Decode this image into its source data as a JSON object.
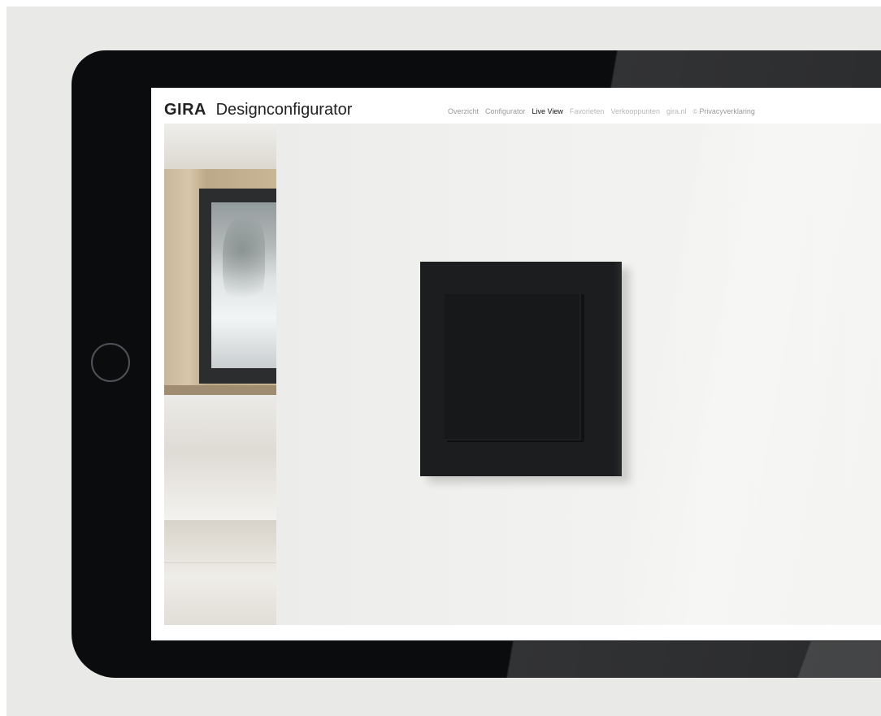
{
  "app": {
    "brand": "GIRA",
    "title": "Designconfigurator"
  },
  "nav": {
    "items": [
      {
        "label": "Overzicht"
      },
      {
        "label": "Configurator"
      },
      {
        "label": "Live View"
      },
      {
        "label": "Favorieten"
      },
      {
        "label": "Verkooppunten"
      },
      {
        "label": "gira.nl"
      }
    ],
    "privacy_label": "Privacyverklaring",
    "privacy_icon": "©"
  },
  "preview": {
    "product_color": "#1b1c1e"
  },
  "icons": {
    "home": "home-button-icon",
    "copyright": "copyright-icon"
  }
}
